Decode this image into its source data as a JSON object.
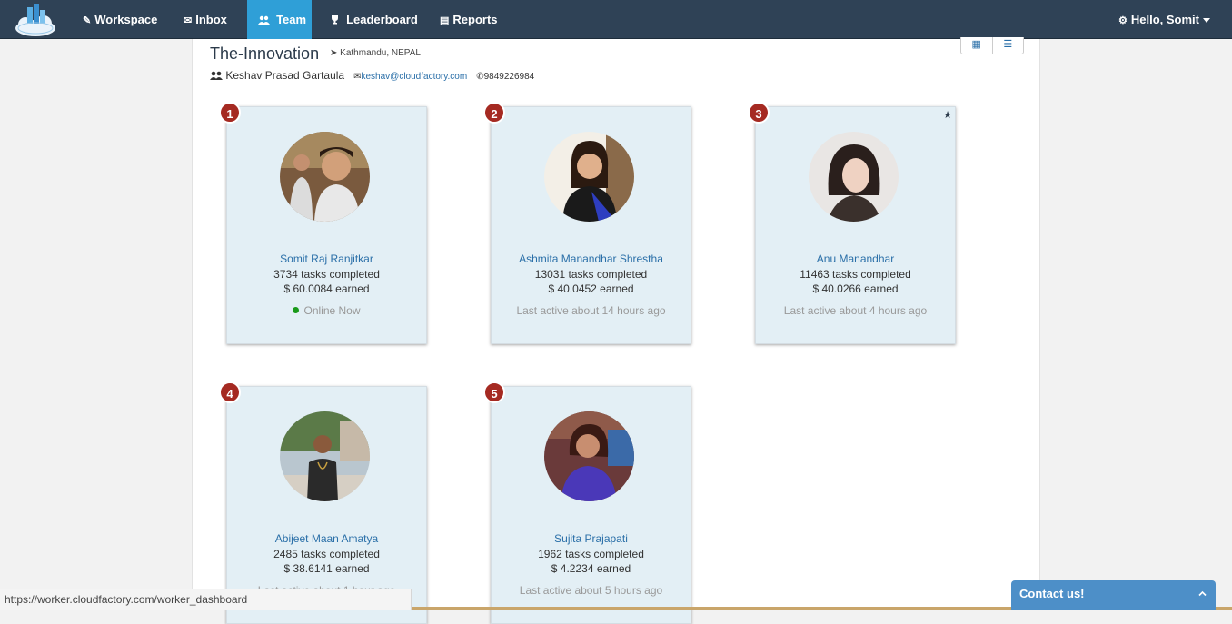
{
  "nav": {
    "items": [
      {
        "icon": "pencil-icon",
        "glyph": "✎",
        "label": "Workspace"
      },
      {
        "icon": "envelope-icon",
        "glyph": "✉",
        "label": "Inbox"
      },
      {
        "icon": "team-icon",
        "glyph": "👥",
        "label": "Team",
        "active": true
      },
      {
        "icon": "trophy-icon",
        "glyph": "🏆",
        "label": "Leaderboard"
      },
      {
        "icon": "list-icon",
        "glyph": "▤",
        "label": "Reports"
      }
    ],
    "user_greeting": "Hello, Somit",
    "colors": {
      "bar": "#2f4256",
      "active": "#2f9fd7"
    }
  },
  "team": {
    "name": "The-Innovation",
    "location": "Kathmandu, NEPAL",
    "leader_name": "Keshav Prasad Gartaula",
    "leader_email": "keshav@cloudfactory.com",
    "leader_phone": "9849226984"
  },
  "members": [
    {
      "rank": "1",
      "name": "Somit Raj Ranjitkar",
      "tasks": "3734 tasks completed",
      "earned": "$ 60.0084 earned",
      "status": "Online Now",
      "online": true,
      "starred": false
    },
    {
      "rank": "2",
      "name": "Ashmita Manandhar Shrestha",
      "tasks": "13031 tasks completed",
      "earned": "$ 40.0452 earned",
      "status": "Last active about 14 hours ago",
      "online": false,
      "starred": false
    },
    {
      "rank": "3",
      "name": "Anu Manandhar",
      "tasks": "11463 tasks completed",
      "earned": "$ 40.0266 earned",
      "status": "Last active about 4 hours ago",
      "online": false,
      "starred": true
    },
    {
      "rank": "4",
      "name": "Abijeet Maan Amatya",
      "tasks": "2485 tasks completed",
      "earned": "$ 38.6141 earned",
      "status": "Last active about 1 hour ago",
      "online": false,
      "starred": false
    },
    {
      "rank": "5",
      "name": "Sujita Prajapati",
      "tasks": "1962 tasks completed",
      "earned": "$ 4.2234 earned",
      "status": "Last active about 5 hours ago",
      "online": false,
      "starred": false
    }
  ],
  "browser_status": "https://worker.cloudfactory.com/worker_dashboard",
  "contact": {
    "label": "Contact us!"
  }
}
